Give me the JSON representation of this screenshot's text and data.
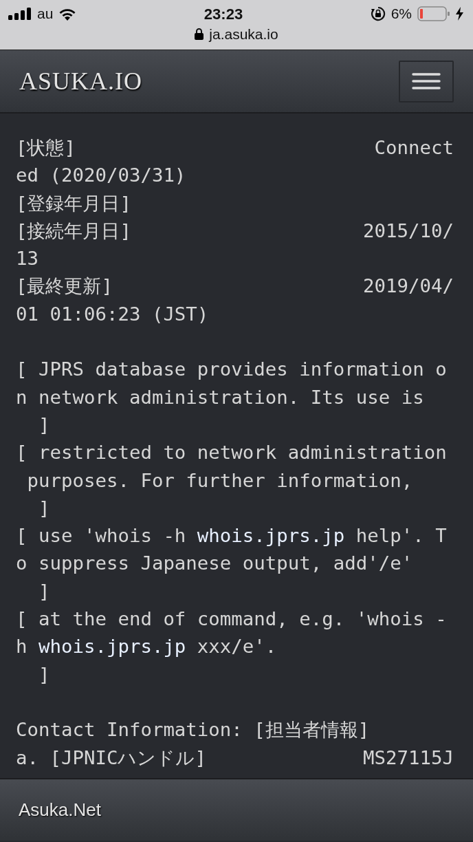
{
  "status_bar": {
    "carrier": "au",
    "time": "23:23",
    "url": "ja.asuka.io",
    "battery": "6%"
  },
  "navbar": {
    "brand": "ASUKA.IO"
  },
  "whois_lines": [
    {
      "kind": "pair",
      "label": "[状態]",
      "value": "Connect"
    },
    {
      "kind": "text",
      "segments": [
        {
          "kind": "plain",
          "text": "ed (2020/03/31)"
        }
      ]
    },
    {
      "kind": "text",
      "segments": [
        {
          "kind": "plain",
          "text": "[登録年月日]"
        }
      ]
    },
    {
      "kind": "pair",
      "label": "[接続年月日]",
      "value": "2015/10/"
    },
    {
      "kind": "text",
      "segments": [
        {
          "kind": "plain",
          "text": "13"
        }
      ]
    },
    {
      "kind": "pair",
      "label": "[最終更新]",
      "value": "2019/04/"
    },
    {
      "kind": "text",
      "segments": [
        {
          "kind": "plain",
          "text": "01 01:06:23 (JST)"
        }
      ]
    },
    {
      "kind": "blank"
    },
    {
      "kind": "text",
      "segments": [
        {
          "kind": "plain",
          "text": "[ JPRS database provides information o"
        }
      ]
    },
    {
      "kind": "text",
      "segments": [
        {
          "kind": "plain",
          "text": "n network administration. Its use is"
        }
      ]
    },
    {
      "kind": "text",
      "segments": [
        {
          "kind": "plain",
          "text": "  ]"
        }
      ]
    },
    {
      "kind": "text",
      "segments": [
        {
          "kind": "plain",
          "text": "[ restricted to network administration"
        }
      ]
    },
    {
      "kind": "text",
      "segments": [
        {
          "kind": "plain",
          "text": " purposes. For further information,"
        }
      ]
    },
    {
      "kind": "text",
      "segments": [
        {
          "kind": "plain",
          "text": "  ]"
        }
      ]
    },
    {
      "kind": "text",
      "segments": [
        {
          "kind": "plain",
          "text": "[ use 'whois -h "
        },
        {
          "kind": "link",
          "text": "whois.jprs.jp"
        },
        {
          "kind": "plain",
          "text": " help'. T"
        }
      ]
    },
    {
      "kind": "text",
      "segments": [
        {
          "kind": "plain",
          "text": "o suppress Japanese output, add'/e'"
        }
      ]
    },
    {
      "kind": "text",
      "segments": [
        {
          "kind": "plain",
          "text": "  ]"
        }
      ]
    },
    {
      "kind": "text",
      "segments": [
        {
          "kind": "plain",
          "text": "[ at the end of command, e.g. 'whois -"
        }
      ]
    },
    {
      "kind": "text",
      "segments": [
        {
          "kind": "plain",
          "text": "h "
        },
        {
          "kind": "link",
          "text": "whois.jprs.jp"
        },
        {
          "kind": "plain",
          "text": " xxx/e'."
        }
      ]
    },
    {
      "kind": "text",
      "segments": [
        {
          "kind": "plain",
          "text": "  ]"
        }
      ]
    },
    {
      "kind": "blank"
    },
    {
      "kind": "text",
      "segments": [
        {
          "kind": "plain",
          "text": "Contact Information: [担当者情報]"
        }
      ]
    },
    {
      "kind": "pair",
      "label": "a. [JPNICハンドル]",
      "value": "MS27115J"
    }
  ],
  "footer": {
    "text": "Asuka.Net"
  }
}
